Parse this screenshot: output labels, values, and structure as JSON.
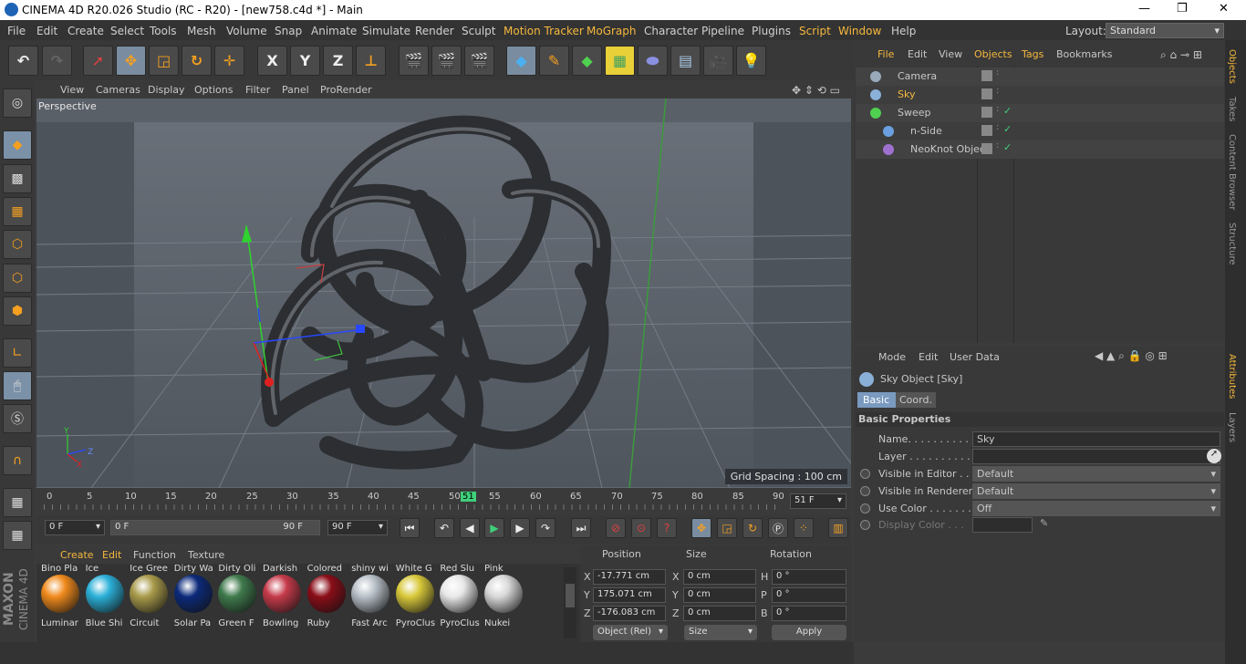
{
  "title": {
    "text": "CINEMA 4D R20.026 Studio (RC - R20) - [new758.c4d *] - Main"
  },
  "window_controls": {
    "minimize": "—",
    "restore": "❐",
    "close": "✕"
  },
  "menu": [
    "File",
    "Edit",
    "Create",
    "Select",
    "Tools",
    "Mesh",
    "Volume",
    "Snap",
    "Animate",
    "Simulate",
    "Render",
    "Sculpt",
    "Motion Tracker",
    "MoGraph",
    "Character",
    "Pipeline",
    "Plugins",
    "Script",
    "Window",
    "Help"
  ],
  "layout": {
    "label": "Layout:",
    "value": "Standard"
  },
  "toolbar": {
    "x": "X",
    "y": "Y",
    "z": "Z"
  },
  "viewport": {
    "menu": [
      "View",
      "Cameras",
      "Display",
      "Options",
      "Filter",
      "Panel",
      "ProRender"
    ],
    "label": "Perspective",
    "grid_spacing": "Grid Spacing : 100 cm"
  },
  "timeline": {
    "ticks": [
      "0",
      "5",
      "10",
      "15",
      "20",
      "25",
      "30",
      "35",
      "40",
      "45",
      "50",
      "51",
      "55",
      "60",
      "65",
      "70",
      "75",
      "80",
      "85",
      "90"
    ],
    "current_frame": "51 F",
    "start": "0 F",
    "range_start": "0 F",
    "range_end": "90 F",
    "end": "90 F"
  },
  "materials": {
    "menu": [
      "Create",
      "Edit",
      "Function",
      "Texture"
    ],
    "top_names": [
      "Bino Pla",
      "Ice",
      "Ice Gree",
      "Dirty Wa",
      "Dirty Oli",
      "Darkish",
      "Colored",
      "shiny wi",
      "White G",
      "Red Slu",
      "Pink"
    ],
    "items": [
      {
        "name": "Luminar",
        "color": "#f08a1c"
      },
      {
        "name": "Blue Shi",
        "color": "#2bb0d8"
      },
      {
        "name": "Circuit",
        "color": "#a89a4a"
      },
      {
        "name": "Solar Pa",
        "color": "#0c2a7a"
      },
      {
        "name": "Green F",
        "color": "#3f7a4c"
      },
      {
        "name": "Bowling",
        "color": "#c53a4a"
      },
      {
        "name": "Ruby",
        "color": "#8a0d18"
      },
      {
        "name": "Fast Arc",
        "color": "#b8c0c8"
      },
      {
        "name": "PyroClus",
        "color": "#d8c83a"
      },
      {
        "name": "PyroClus",
        "color": "#e8e8e8"
      },
      {
        "name": "Nukei",
        "color": "#d8d8d8"
      }
    ]
  },
  "coords": {
    "headers": [
      "Position",
      "Size",
      "Rotation"
    ],
    "rows": [
      {
        "axis": "X",
        "pos": "-17.771 cm",
        "size_axis": "X",
        "size": "0 cm",
        "rot_axis": "H",
        "rot": "0 °"
      },
      {
        "axis": "Y",
        "pos": "175.071 cm",
        "size_axis": "Y",
        "size": "0 cm",
        "rot_axis": "P",
        "rot": "0 °"
      },
      {
        "axis": "Z",
        "pos": "-176.083 cm",
        "size_axis": "Z",
        "size": "0 cm",
        "rot_axis": "B",
        "rot": "0 °"
      }
    ],
    "mode": "Object (Rel)",
    "size_mode": "Size",
    "apply": "Apply"
  },
  "objects": {
    "menu": [
      "File",
      "Edit",
      "View",
      "Objects",
      "Tags",
      "Bookmarks"
    ],
    "items": [
      {
        "name": "Camera",
        "color": "#c8c8c8"
      },
      {
        "name": "Sky",
        "color": "#f5b83d"
      },
      {
        "name": "Sweep",
        "color": "#c8c8c8"
      },
      {
        "name": "n-Side",
        "color": "#c8c8c8"
      },
      {
        "name": "NeoKnot Object",
        "color": "#c8c8c8"
      }
    ]
  },
  "attributes": {
    "menu": [
      "Mode",
      "Edit",
      "User Data"
    ],
    "object": "Sky Object [Sky]",
    "tabs": [
      "Basic",
      "Coord."
    ],
    "section": "Basic Properties",
    "fields": [
      {
        "label": "Name. . . . . . . . . . . .",
        "value": "Sky"
      },
      {
        "label": "Layer . . . . . . . . . . .",
        "value": ""
      },
      {
        "label": "Visible in Editor . . .",
        "value": "Default"
      },
      {
        "label": "Visible in Renderer",
        "value": "Default"
      },
      {
        "label": "Use Color . . . . . . .",
        "value": "Off"
      },
      {
        "label": "Display Color . . .",
        "value": ""
      }
    ]
  },
  "right_tabs": [
    "Objects",
    "Takes",
    "Content Browser",
    "Structure",
    "Attributes",
    "Layers"
  ],
  "brand": {
    "maxon": "MAXON",
    "product": "CINEMA 4D"
  }
}
